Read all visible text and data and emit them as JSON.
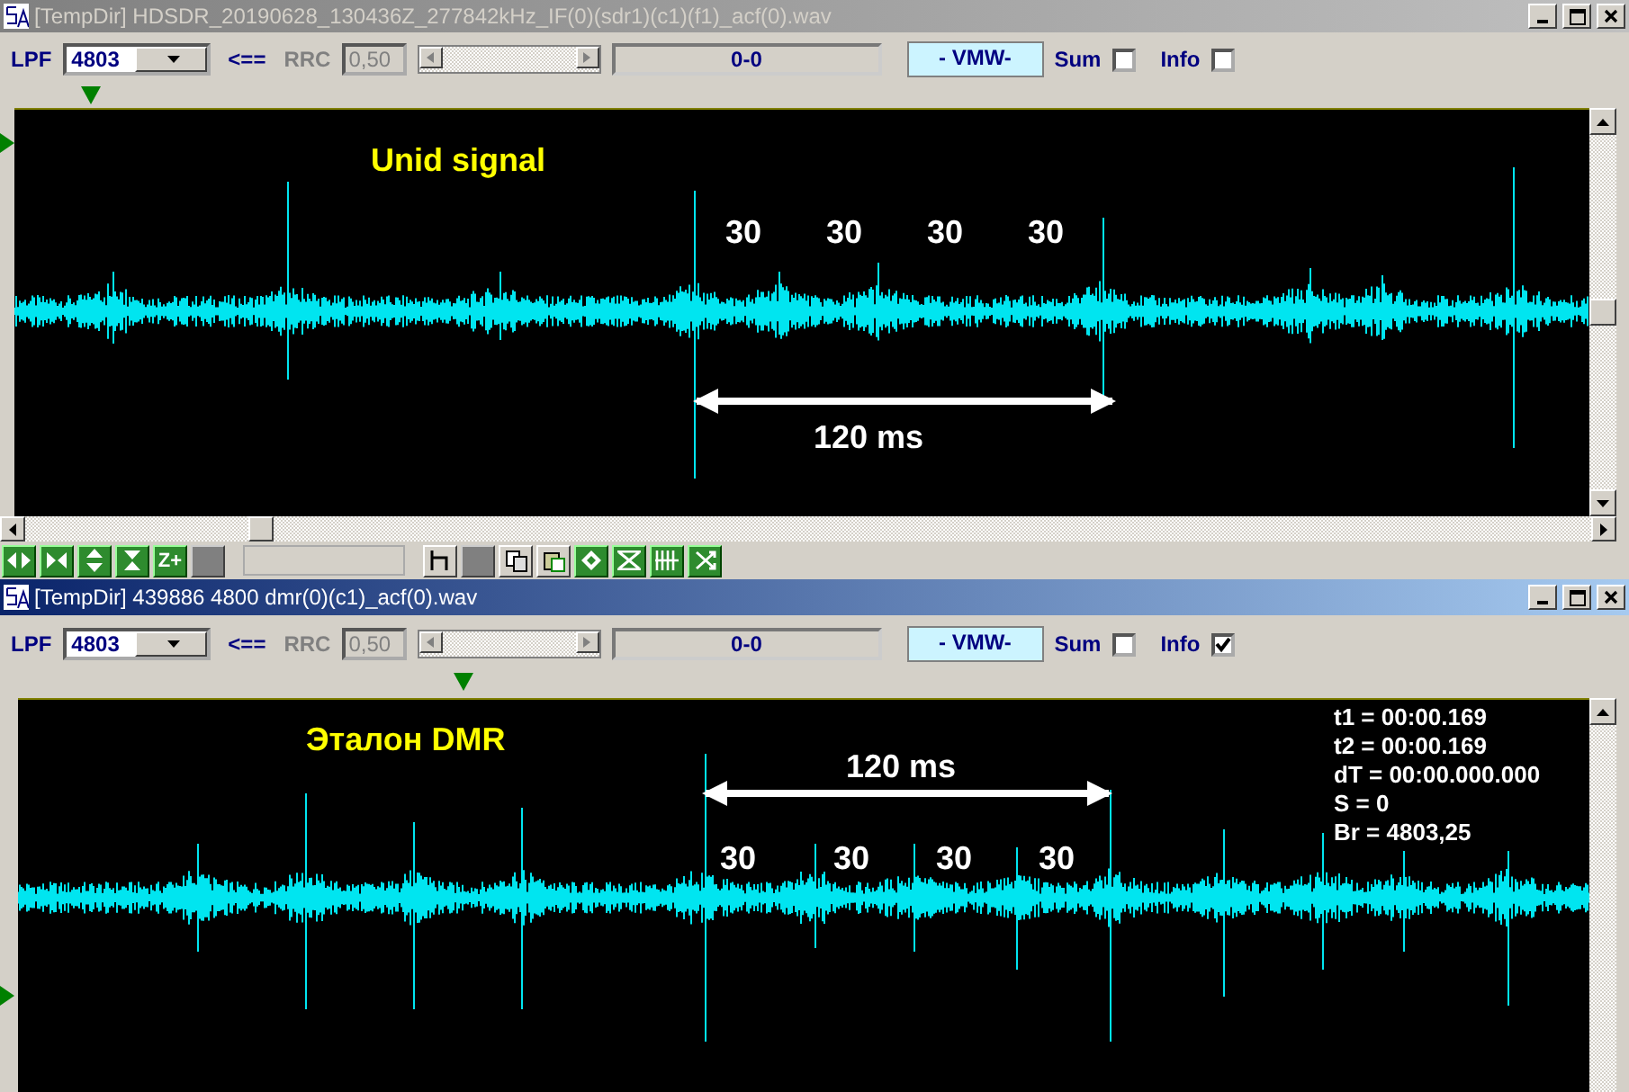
{
  "windows": [
    {
      "title": "[TempDir] HDSDR_20190628_130436Z_277842kHz_IF(0)(sdr1)(c1)(f1)_acf(0).wav",
      "active": false,
      "toolbar": {
        "filter_label": "LPF",
        "filter_value": "4803",
        "arrow": "<==",
        "rrc_label": "RRC",
        "rrc_value": "0,50",
        "range": "0-0",
        "mode": "- VMW-",
        "sum_label": "Sum",
        "sum_checked": false,
        "info_label": "Info",
        "info_checked": false
      },
      "plot": {
        "title": "Unid signal",
        "counts": [
          "30",
          "30",
          "30",
          "30"
        ],
        "span": "120 ms"
      },
      "zoom_label": "Z+"
    },
    {
      "title": "[TempDir] 439886 4800 dmr(0)(c1)_acf(0).wav",
      "active": true,
      "toolbar": {
        "filter_label": "LPF",
        "filter_value": "4803",
        "arrow": "<==",
        "rrc_label": "RRC",
        "rrc_value": "0,50",
        "range": "0-0",
        "mode": "- VMW-",
        "sum_label": "Sum",
        "sum_checked": false,
        "info_label": "Info",
        "info_checked": true
      },
      "plot": {
        "title": "Эталон DMR",
        "counts": [
          "30",
          "30",
          "30",
          "30"
        ],
        "span": "120 ms",
        "info": [
          "t1 = 00:00.169",
          "t2 = 00:00.169",
          "dT = 00:00.000.000",
          "S = 0",
          "Br = 4803,25"
        ]
      }
    }
  ]
}
